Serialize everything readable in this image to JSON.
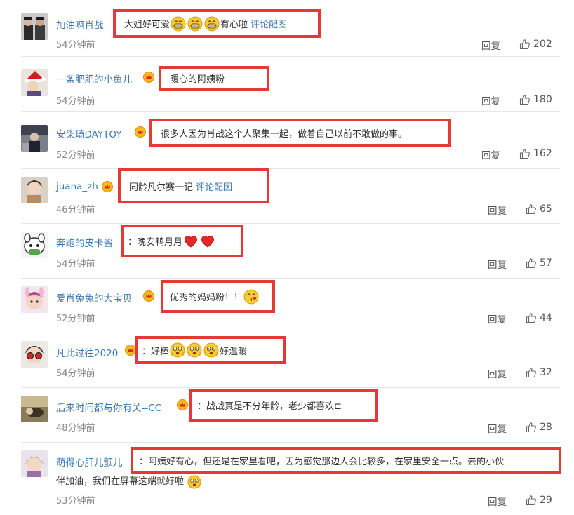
{
  "comments": [
    {
      "username": "加油啊肖战",
      "text": "大姐好可爱",
      "text_after": "有心啦",
      "link": "评论配图",
      "time": "54分钟前",
      "reply": "回复",
      "likes": "202",
      "emojis": [
        "grin-emoji",
        "grin-emoji",
        "grin-emoji"
      ]
    },
    {
      "username": "一条肥肥的小鱼儿",
      "text": "暖心的阿姨粉",
      "time": "54分钟前",
      "reply": "回复",
      "likes": "180"
    },
    {
      "username": "安柒琦DAYTOY",
      "text": "很多人因为肖战这个人聚集一起，做着自己以前不敢做的事。",
      "time": "52分钟前",
      "reply": "回复",
      "likes": "162"
    },
    {
      "username": "juana_zh",
      "text": "同龄凡尔赛一记",
      "link": "评论配图",
      "time": "46分钟前",
      "reply": "回复",
      "likes": "65"
    },
    {
      "username": "奔跑的皮卡酱",
      "text": "：晚安鸭月月",
      "time": "54分钟前",
      "reply": "回复",
      "likes": "57",
      "emojis": [
        "heart-emoji",
        "heart-emoji"
      ]
    },
    {
      "username": "爱肖兔兔的大宝贝",
      "text": "优秀的妈妈粉！！",
      "time": "52分钟前",
      "reply": "回复",
      "likes": "44",
      "emojis": [
        "kiss-emoji"
      ]
    },
    {
      "username": "凡此过往2020",
      "text": "：好棒",
      "text_after": "好温暖",
      "time": "54分钟前",
      "reply": "回复",
      "likes": "32",
      "emojis": [
        "moved-emoji",
        "moved-emoji",
        "moved-emoji"
      ]
    },
    {
      "username": "后来时间都与你有关--CC",
      "text": "：战战真是不分年龄，老少都喜欢⊏",
      "time": "48分钟前",
      "reply": "回复",
      "likes": "28"
    },
    {
      "username": "萌得心肝儿颤儿",
      "text": "：阿姨好有心，但还是在家里看吧，因为感觉那边人会比较多，在家里安全一点。去的小伙",
      "text_line2": "伴加油，我们在屏幕这端就好啦",
      "time": "53分钟前",
      "reply": "回复",
      "likes": "29",
      "emojis": [
        "moved-emoji"
      ]
    }
  ]
}
